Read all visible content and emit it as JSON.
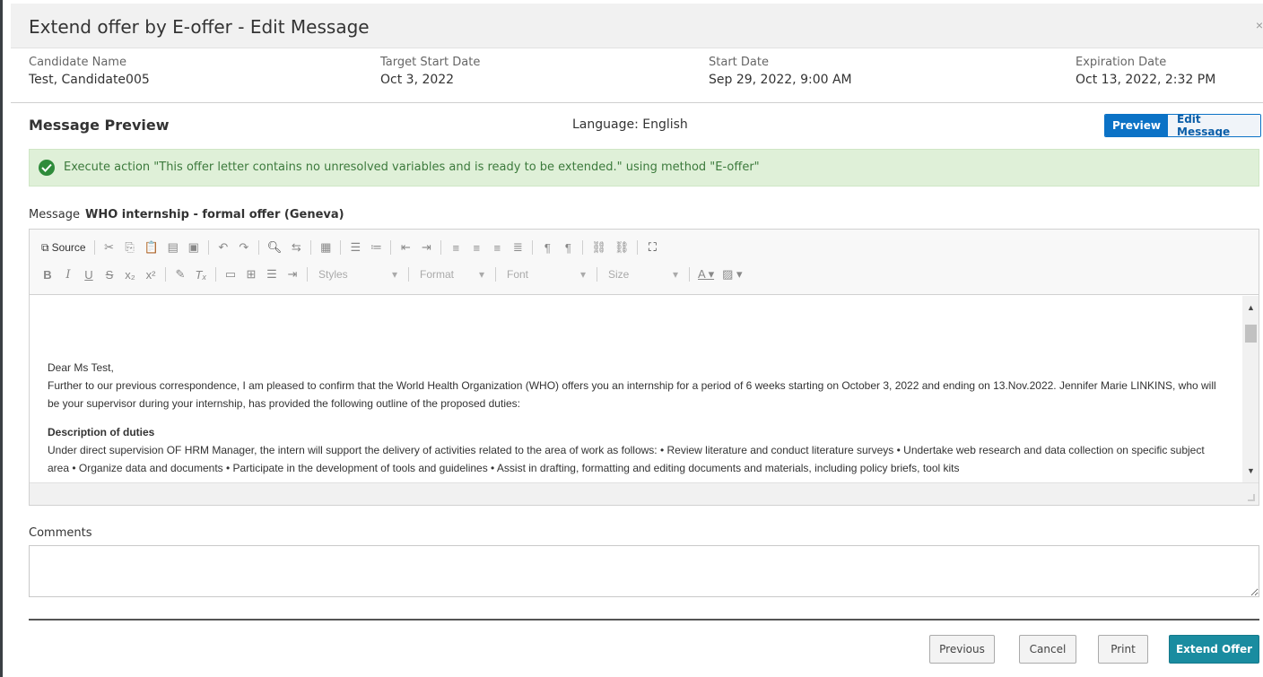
{
  "modal": {
    "title": "Extend offer by E-offer - Edit Message",
    "close_glyph": "×"
  },
  "info": {
    "candidate_label": "Candidate Name",
    "candidate_value": "Test, Candidate005",
    "target_label": "Target Start Date",
    "target_value": "Oct 3, 2022",
    "start_label": "Start Date",
    "start_value": "Sep 29, 2022, 9:00 AM",
    "expiration_label": "Expiration Date",
    "expiration_value": "Oct 13, 2022, 2:32 PM"
  },
  "preview": {
    "title": "Message Preview",
    "language": "Language: English",
    "preview_btn": "Preview",
    "edit_btn": "Edit Message"
  },
  "alert": {
    "text": "Execute action \"This offer letter contains no unresolved variables and is ready to be extended.\" using method \"E-offer\""
  },
  "message": {
    "label": "Message",
    "template_name": "WHO internship - formal offer (Geneva)"
  },
  "toolbar": {
    "source_label": "Source",
    "styles_label": "Styles",
    "format_label": "Format",
    "font_label": "Font",
    "size_label": "Size"
  },
  "letter": {
    "greeting": "Dear Ms Test,",
    "para1": "Further to our previous correspondence, I am pleased to confirm that the World Health Organization (WHO) offers you an internship for a period of 6 weeks starting on October 3, 2022 and ending on 13.Nov.2022.  Jennifer Marie LINKINS, who will be your supervisor during your internship, has provided the following outline of the proposed duties:",
    "duties_heading": "Description of duties",
    "duties_text": "Under direct supervision OF HRM Manager, the intern will support the delivery of activities related to the area of work as follows: • Review literature and conduct literature surveys • Undertake web research and data collection on specific subject area • Organize data and documents • Participate in the development of tools and guidelines • Assist in drafting, formatting and editing documents and materials, including policy briefs, tool kits"
  },
  "comments": {
    "label": "Comments",
    "value": ""
  },
  "actions": {
    "previous": "Previous",
    "cancel": "Cancel",
    "print": "Print",
    "extend": "Extend Offer"
  },
  "colors": {
    "primary": "#0b72c6",
    "success_bg": "#dff0d8",
    "success_icon": "#2e8b3a",
    "extend_btn": "#1a8ca0"
  }
}
